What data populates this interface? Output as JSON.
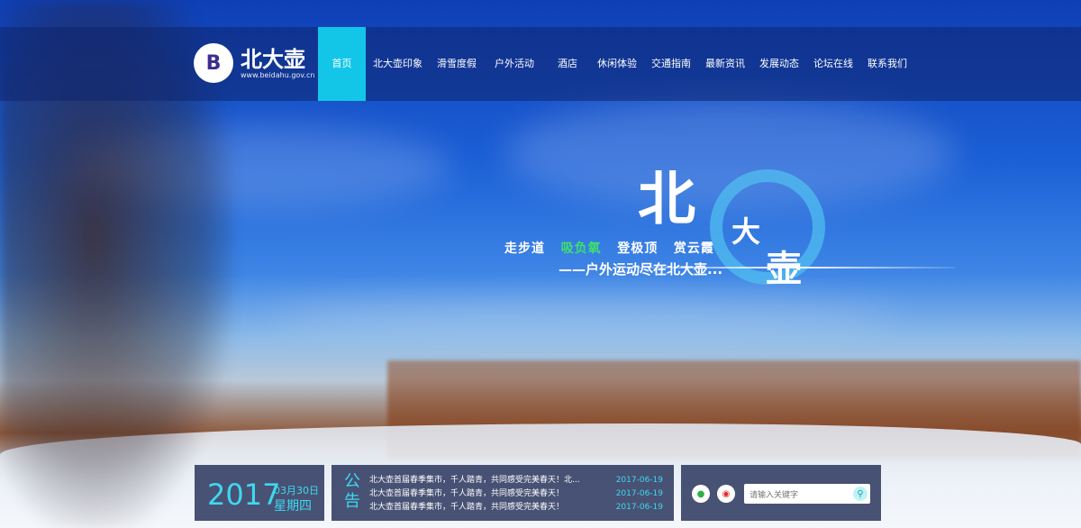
{
  "logo": {
    "mark": "B",
    "name": "北大壶",
    "url": "www.beidahu.gov.cn"
  },
  "nav": {
    "items": [
      "首页",
      "北大壶印象",
      "滑雪度假",
      "户外活动",
      "酒店",
      "休闲体验",
      "交通指南",
      "最新资讯",
      "发展动态",
      "论坛在线",
      "联系我们"
    ],
    "active": "首页",
    "active_color": "#13c6e8"
  },
  "hero": {
    "tags": [
      "走步道",
      "吸负氧",
      "登极顶",
      "赏云霞"
    ],
    "highlight_color": "#3de06a",
    "subtitle": "——户外运动尽在北大壶...",
    "big_chars": [
      "北",
      "大",
      "壶"
    ]
  },
  "date": {
    "year": "2017",
    "month_day": "03月30日",
    "weekday": "星期四"
  },
  "notice": {
    "tag": "公告",
    "items": [
      {
        "title": "北大壶首届春季集市，千人踏青，共同感受完美春天！北...",
        "date": "2017-06-19"
      },
      {
        "title": "北大壶首届春季集市，千人踏青，共同感受完美春天！",
        "date": "2017-06-19"
      },
      {
        "title": "北大壶首届春季集市，千人踏青，共同感受完美春天！",
        "date": "2017-06-19"
      }
    ]
  },
  "social": {
    "wechat_icon": "wechat-icon",
    "weibo_icon": "weibo-icon"
  },
  "search": {
    "placeholder": "请输入关键字",
    "icon": "search-icon"
  }
}
